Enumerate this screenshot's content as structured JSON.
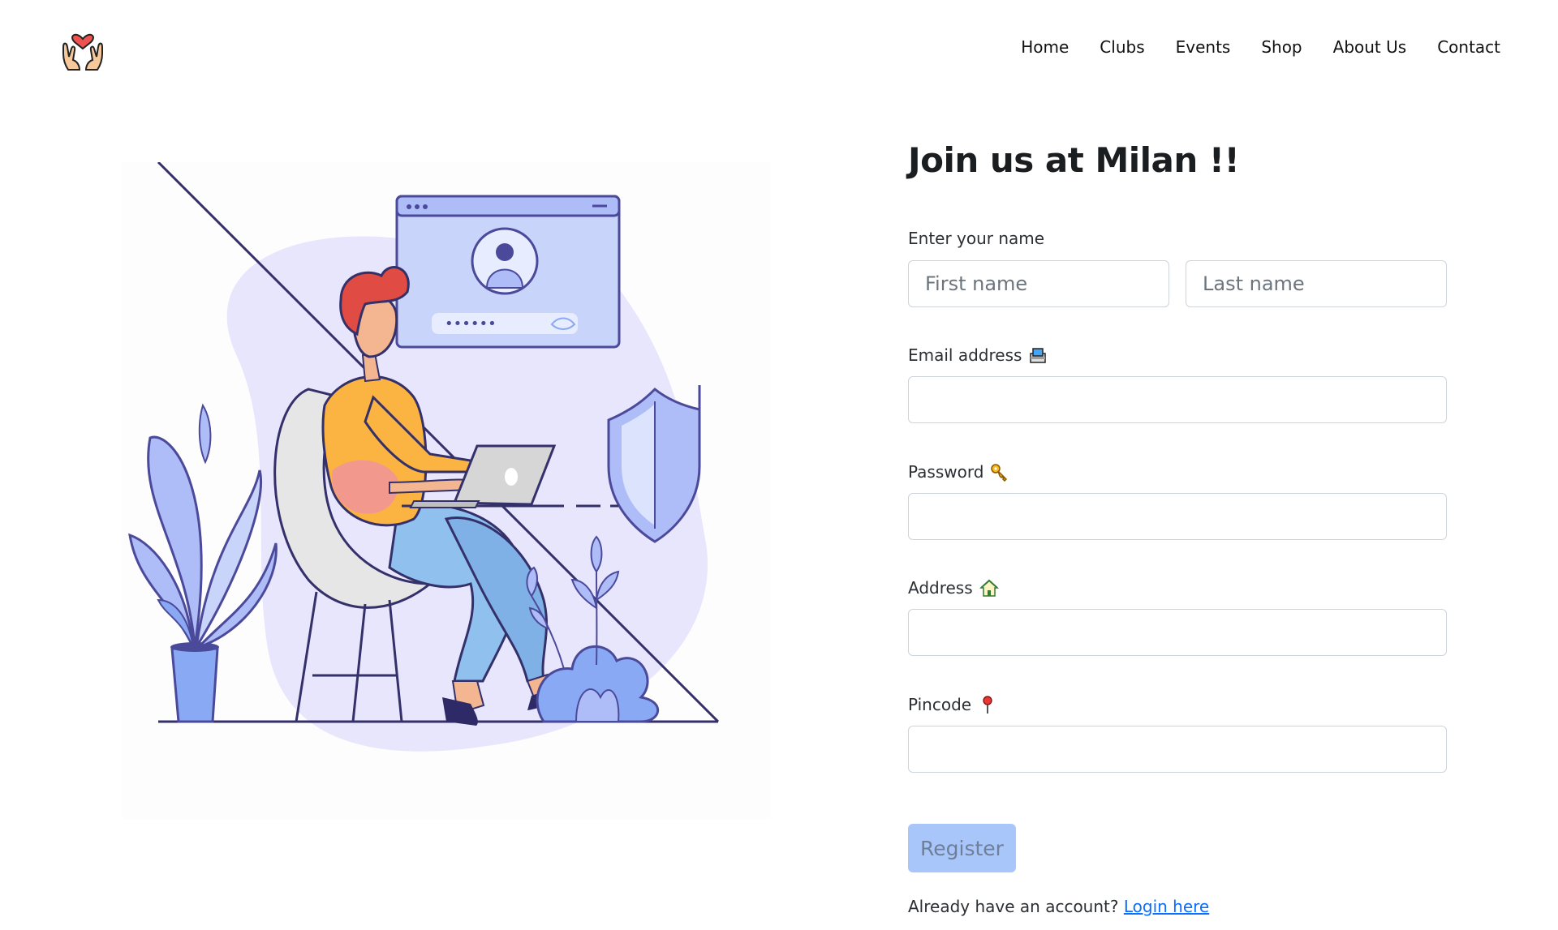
{
  "nav": {
    "logo_icon": "heart-hands-icon",
    "links": [
      "Home",
      "Clubs",
      "Events",
      "Shop",
      "About Us",
      "Contact"
    ]
  },
  "form": {
    "title": "Join us at Milan !!",
    "name_label": "Enter your name",
    "first_name_placeholder": "First name",
    "last_name_placeholder": "Last name",
    "email_label": "Email address",
    "email_icon": "inbox-tray-icon",
    "password_label": "Password",
    "password_icon": "key-icon",
    "address_label": "Address",
    "address_icon": "house-icon",
    "pincode_label": "Pincode",
    "pincode_icon": "pushpin-icon",
    "register_label": "Register",
    "login_prompt": "Already have an account?",
    "login_link": "Login here"
  },
  "illustration": {
    "password_dots": "••••••"
  },
  "colors": {
    "primary": "#0d6efd",
    "register_disabled_bg": "#a9c6fb",
    "illustration_blob": "#e8e6fc",
    "illustration_blue": "#8aa9f5"
  }
}
